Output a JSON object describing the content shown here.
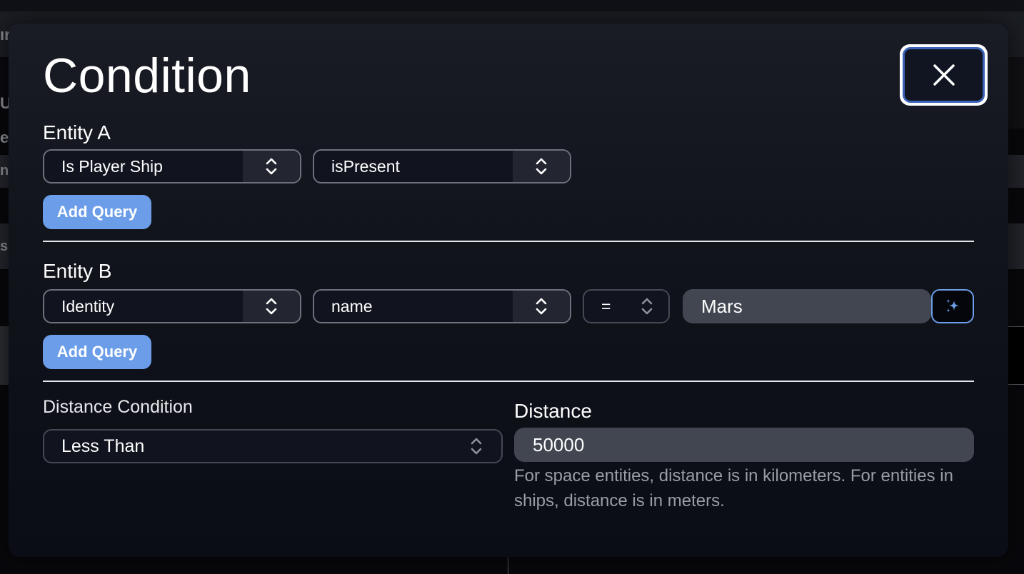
{
  "background": {
    "left_fragments": [
      "ır",
      "U",
      "e",
      "ne",
      "ss"
    ]
  },
  "modal": {
    "title": "Condition",
    "close_icon": "close-x-icon",
    "entity_a": {
      "label": "Entity A",
      "selects": [
        {
          "value": "Is Player Ship",
          "icon": "chevron-updown-icon"
        },
        {
          "value": "isPresent",
          "icon": "chevron-updown-icon"
        }
      ],
      "add_query_label": "Add Query"
    },
    "entity_b": {
      "label": "Entity B",
      "selects": [
        {
          "value": "Identity",
          "icon": "chevron-updown-icon"
        },
        {
          "value": "name",
          "icon": "chevron-updown-icon"
        }
      ],
      "operator": {
        "value": "=",
        "icon": "chevron-updown-icon"
      },
      "value_input": "Mars",
      "magic_icon": "sparkles-icon",
      "add_query_label": "Add Query"
    },
    "distance_condition": {
      "label": "Distance Condition",
      "value": "Less Than",
      "icon": "chevron-updown-icon"
    },
    "distance": {
      "label": "Distance",
      "value": "50000",
      "help": "For space entities, distance is in kilometers. For entities in ships, distance is in meters."
    }
  },
  "colors": {
    "accent": "#6b9de9",
    "close_ring": "#3a63b8",
    "input_bg": "#414651",
    "help_text": "#9a9ca6"
  }
}
